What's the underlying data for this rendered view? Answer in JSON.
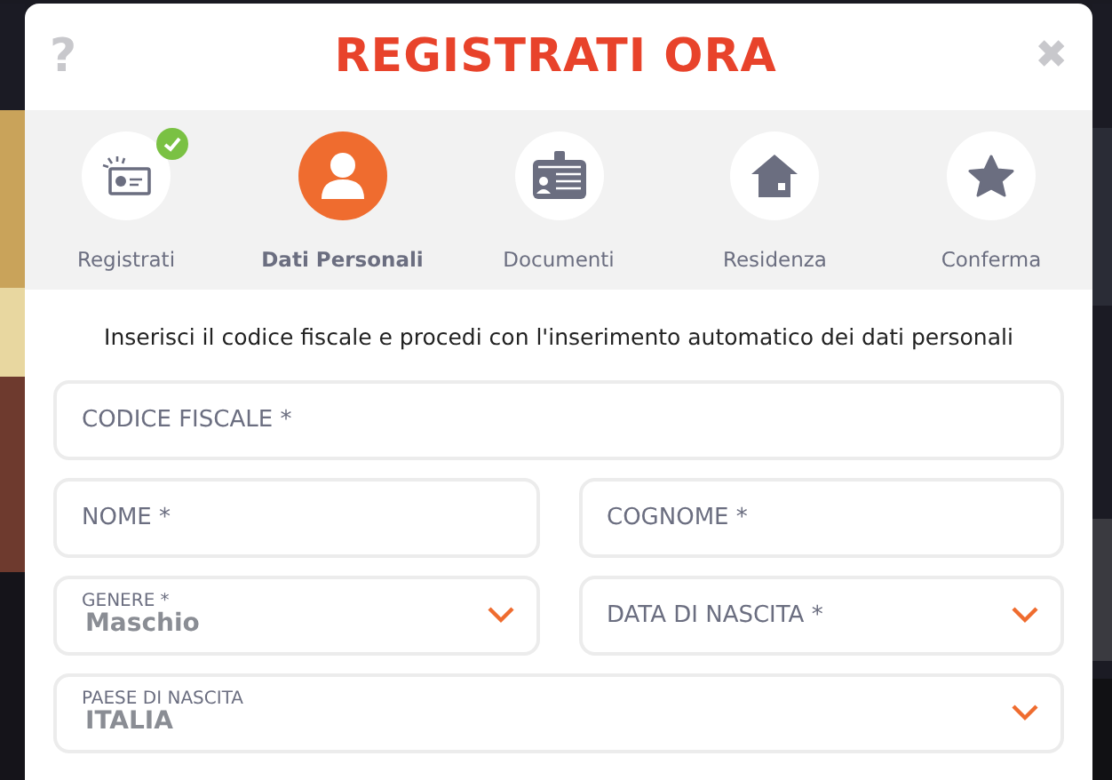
{
  "modal": {
    "help": "?",
    "title": "REGISTRATI ORA",
    "close": "✖"
  },
  "steps": [
    {
      "label": "Registrati",
      "selected": false,
      "done": true
    },
    {
      "label": "Dati Personali",
      "selected": true,
      "done": false
    },
    {
      "label": "Documenti",
      "selected": false,
      "done": false
    },
    {
      "label": "Residenza",
      "selected": false,
      "done": false
    },
    {
      "label": "Conferma",
      "selected": false,
      "done": false
    }
  ],
  "intro": "Inserisci il codice fiscale e procedi con l'inserimento automatico dei dati personali",
  "fields": [
    {
      "kind": "text",
      "placeholder": "CODICE FISCALE *"
    },
    {
      "kind": "text",
      "placeholder": "NOME *"
    },
    {
      "kind": "text",
      "placeholder": "COGNOME *"
    },
    {
      "kind": "select",
      "label": "GENERE *",
      "value": "Maschio"
    },
    {
      "kind": "select",
      "placeholder": "DATA DI NASCITA *"
    },
    {
      "kind": "select",
      "label": "PAESE DI NASCITA",
      "value": "ITALIA"
    }
  ]
}
